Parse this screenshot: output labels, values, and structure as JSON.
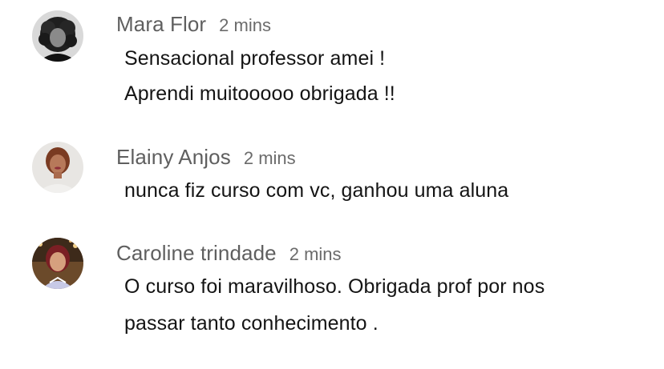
{
  "comments": [
    {
      "author": "Mara Flor",
      "time": "2 mins",
      "avatar": "avatar-icon",
      "lines": [
        "Sensacional professor amei !",
        "Aprendi muitooooo obrigada !!"
      ]
    },
    {
      "author": "Elainy Anjos",
      "time": "2 mins",
      "avatar": "avatar-icon",
      "lines": [
        "nunca fiz curso com vc, ganhou uma aluna"
      ]
    },
    {
      "author": "Caroline trindade",
      "time": "2 mins",
      "avatar": "avatar-icon",
      "lines": [
        "O curso foi maravilhoso. Obrigada prof por nos",
        "passar tanto conhecimento ."
      ]
    }
  ],
  "colors": {
    "author_text": "#5f5f5f",
    "body_text": "#141414",
    "background": "#ffffff"
  }
}
